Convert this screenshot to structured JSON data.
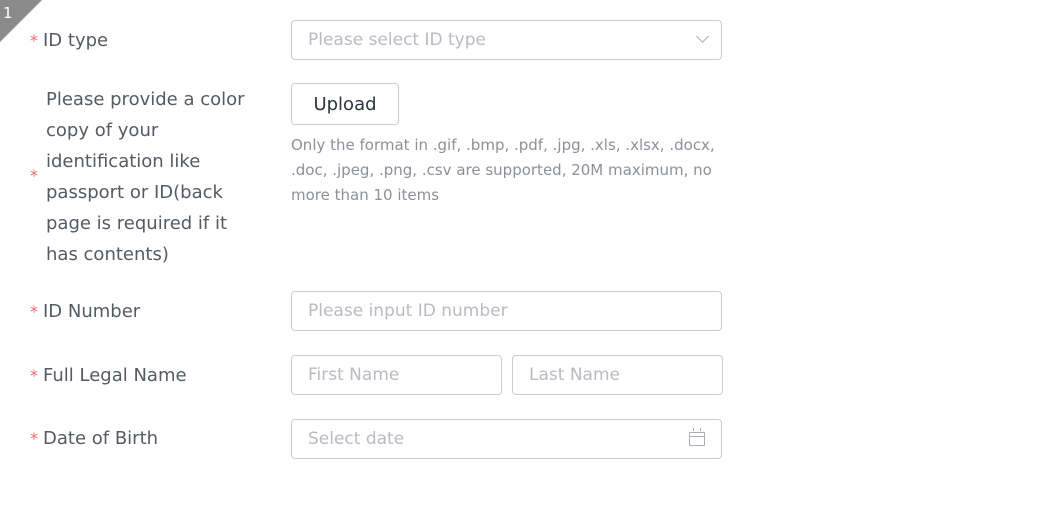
{
  "step_badge": "1",
  "form": {
    "id_type": {
      "label": "ID type",
      "required_mark": "*",
      "placeholder": "Please select ID type"
    },
    "identification_upload": {
      "label": "Please provide a color copy of your identification like passport or ID(back page is required if it has contents)",
      "required_mark": "*",
      "button_label": "Upload",
      "hint": "Only the format in .gif, .bmp, .pdf, .jpg, .xls, .xlsx, .docx, .doc, .jpeg, .png, .csv are supported, 20M maximum, no more than 10 items"
    },
    "id_number": {
      "label": "ID Number",
      "required_mark": "*",
      "placeholder": "Please input ID number"
    },
    "full_legal_name": {
      "label": "Full Legal Name",
      "required_mark": "*",
      "first_placeholder": "First Name",
      "last_placeholder": "Last Name"
    },
    "date_of_birth": {
      "label": "Date of Birth",
      "required_mark": "*",
      "placeholder": "Select date"
    }
  },
  "colors": {
    "required": "#f56c6c",
    "border": "#c8ccd4",
    "placeholder": "#b7bbc2",
    "badge": "#8a8a8a"
  }
}
